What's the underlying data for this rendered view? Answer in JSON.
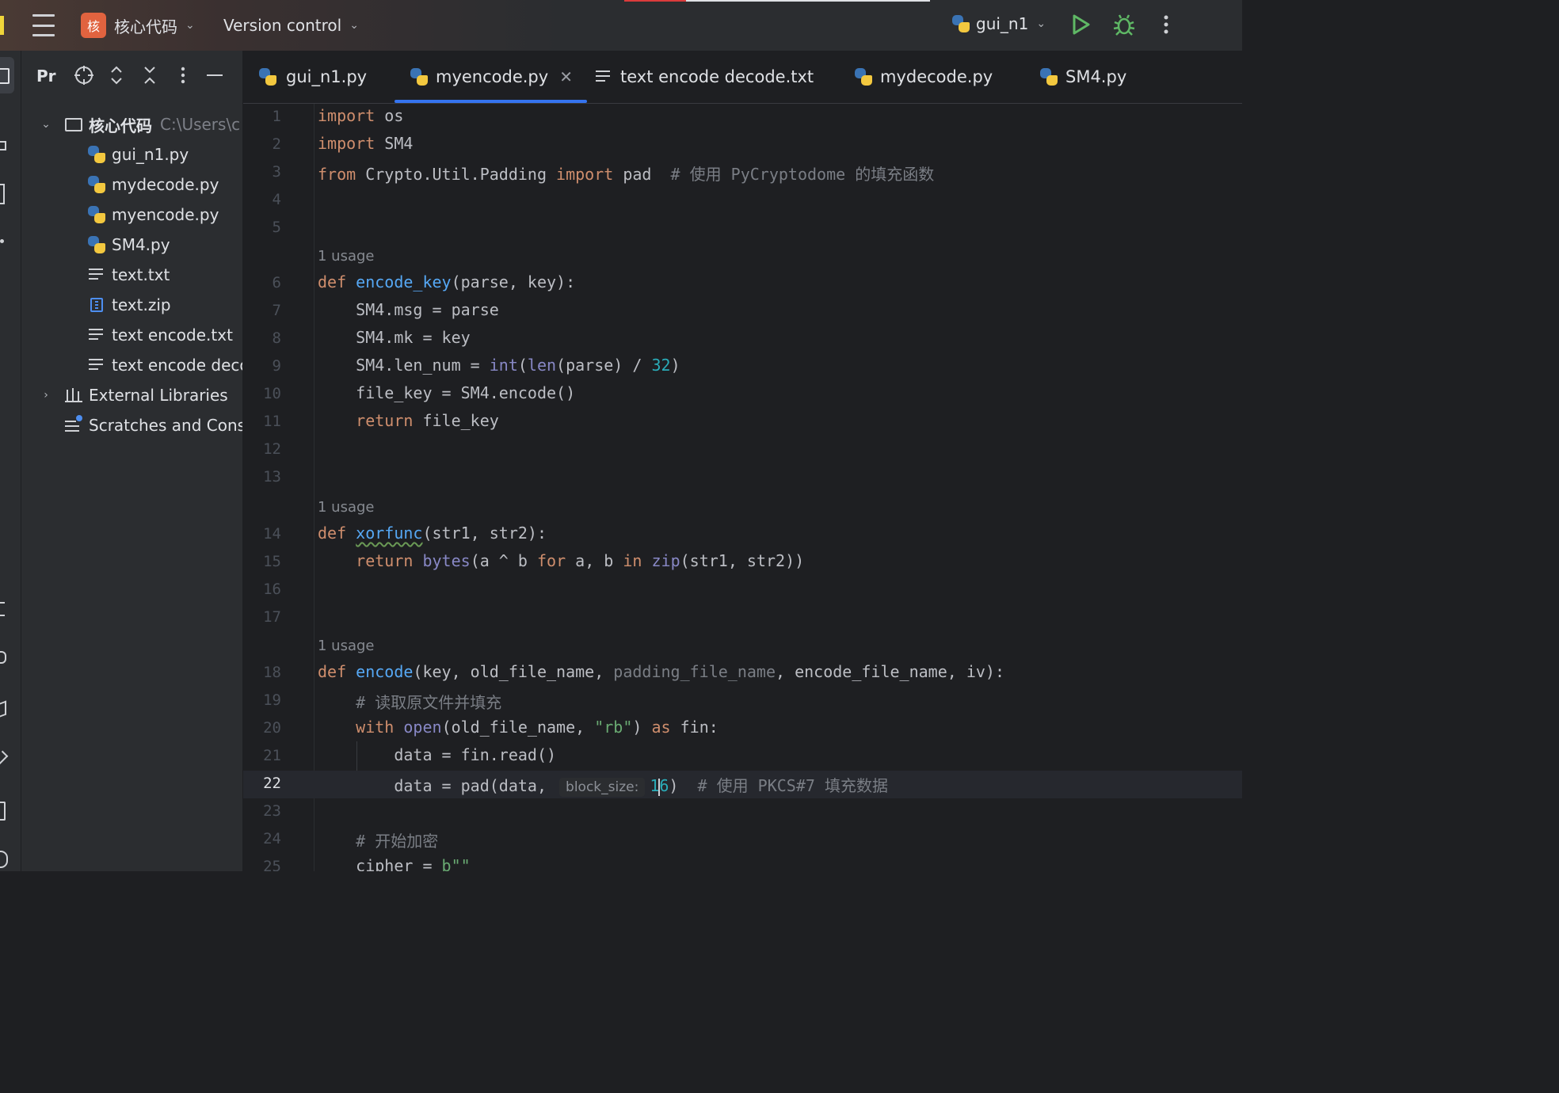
{
  "titlebar": {
    "project_badge": "核",
    "project_name": "核心代码",
    "vcs_label": "Version control",
    "run_config": "gui_n1"
  },
  "project_panel": {
    "title": "Pr",
    "root": {
      "name": "核心代码",
      "path": "C:\\Users\\c"
    },
    "files": [
      {
        "name": "gui_n1.py",
        "type": "py"
      },
      {
        "name": "mydecode.py",
        "type": "py"
      },
      {
        "name": "myencode.py",
        "type": "py"
      },
      {
        "name": "SM4.py",
        "type": "py"
      },
      {
        "name": "text.txt",
        "type": "txt"
      },
      {
        "name": "text.zip",
        "type": "zip"
      },
      {
        "name": "text encode.txt",
        "type": "txt"
      },
      {
        "name": "text encode deco",
        "type": "txt"
      }
    ],
    "external_libraries": "External Libraries",
    "scratches": "Scratches and Cons"
  },
  "tabs": [
    {
      "label": "gui_n1.py",
      "type": "py",
      "active": false
    },
    {
      "label": "myencode.py",
      "type": "py",
      "active": true
    },
    {
      "label": "text encode decode.txt",
      "type": "txt",
      "active": false
    },
    {
      "label": "mydecode.py",
      "type": "py",
      "active": false
    },
    {
      "label": "SM4.py",
      "type": "py",
      "active": false
    }
  ],
  "editor": {
    "usage_hint": "1 usage",
    "inlay_hint": "block_size:",
    "line_numbers": [
      "1",
      "2",
      "3",
      "4",
      "5",
      "6",
      "7",
      "8",
      "9",
      "10",
      "11",
      "12",
      "13",
      "14",
      "15",
      "16",
      "17",
      "18",
      "19",
      "20",
      "21",
      "22",
      "23",
      "24",
      "25"
    ],
    "current_line": "22",
    "code": {
      "l1": [
        "import",
        " os"
      ],
      "l2": [
        "import",
        " SM4"
      ],
      "l3": [
        "from",
        " Crypto.Util.Padding ",
        "import",
        " pad  ",
        "# 使用 PyCryptodome 的填充函数"
      ],
      "l6": [
        "def",
        " ",
        "encode_key",
        "(parse, key):"
      ],
      "l7": "    SM4.msg = parse",
      "l8": "    SM4.mk = key",
      "l9": [
        "    SM4.len_num = ",
        "int",
        "(",
        "len",
        "(parse) / ",
        "32",
        ")"
      ],
      "l10": "    file_key = SM4.encode()",
      "l11": [
        "    ",
        "return",
        " file_key"
      ],
      "l14": [
        "def",
        " ",
        "xorfunc",
        "(str1, str2):"
      ],
      "l15": [
        "    ",
        "return",
        " ",
        "bytes",
        "(a ^ b ",
        "for",
        " a, b ",
        "in",
        " ",
        "zip",
        "(str1, str2))"
      ],
      "l18": [
        "def",
        " ",
        "encode",
        "(key, old_file_name, ",
        "padding_file_name",
        ", encode_file_name, iv):"
      ],
      "l19": "    # 读取原文件并填充",
      "l20": [
        "    ",
        "with",
        " ",
        "open",
        "(old_file_name, ",
        "\"rb\"",
        ") ",
        "as",
        " fin:"
      ],
      "l21": "        data = fin.read()",
      "l22": [
        "        data = pad(data, ",
        "1",
        "6",
        ")  ",
        "# 使用 PKCS#7 填充数据"
      ],
      "l24": "    # 开始加密",
      "l25": [
        "    cipher = ",
        "b\"\""
      ]
    }
  }
}
